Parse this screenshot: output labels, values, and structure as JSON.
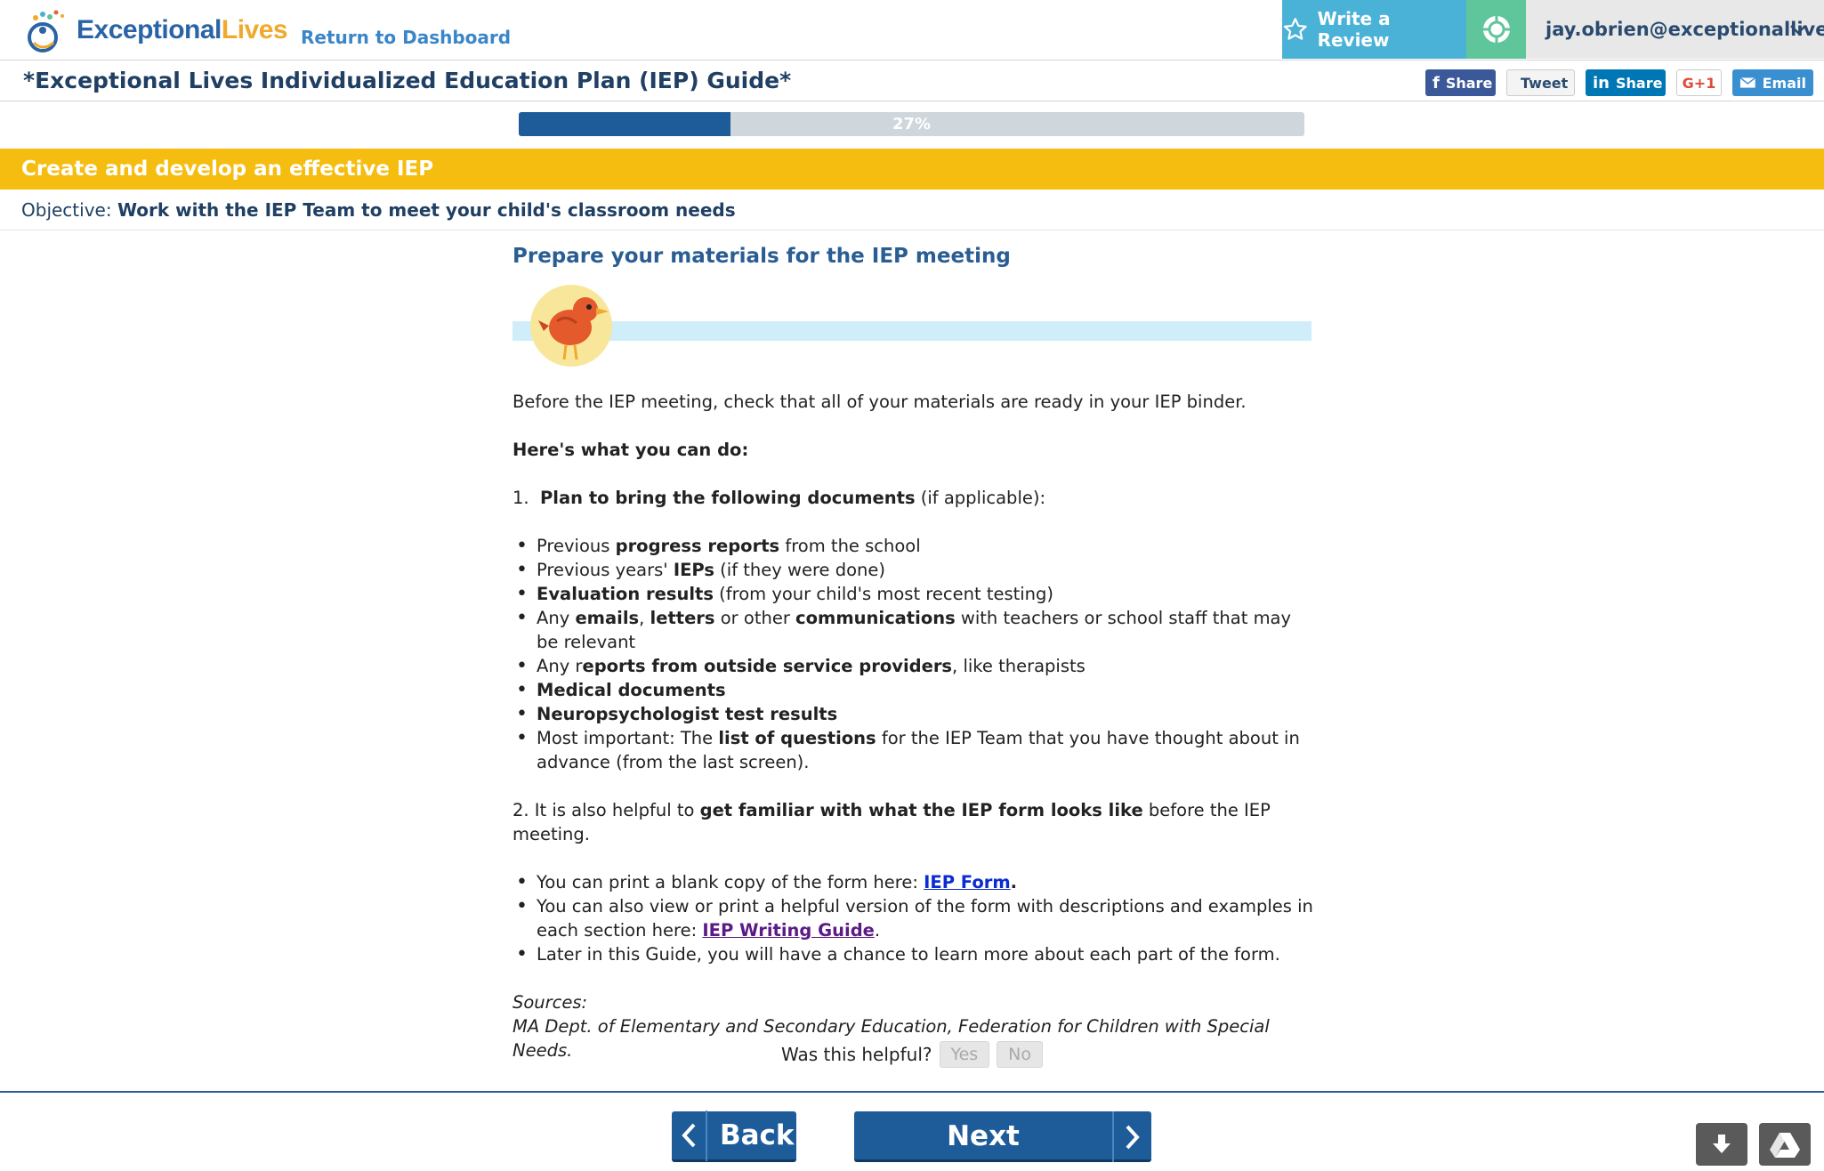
{
  "header": {
    "logo": {
      "part1": "Exceptional",
      "part2": "Lives"
    },
    "return_link": "Return to Dashboard",
    "write_review": "Write a Review",
    "user_email": "jay.obrien@exceptionallive"
  },
  "titlebar": {
    "title": "*Exceptional Lives Individualized Education Plan (IEP) Guide*",
    "share": {
      "facebook": "Share",
      "twitter": "Tweet",
      "linkedin": "Share",
      "google": "G+1",
      "email": "Email"
    }
  },
  "progress": {
    "label": "27%",
    "value": 0.27
  },
  "section": {
    "banner": "Create and develop an effective IEP",
    "objective_label": "Objective:",
    "objective_text": "Work with the IEP Team to meet your child's classroom needs"
  },
  "content": {
    "heading": "Prepare your materials for the IEP meeting",
    "intro": "Before the IEP meeting, check that all of your materials are ready in your IEP binder.",
    "what_you_can_do": "Here's what you can do:",
    "step1": {
      "num": "1.",
      "bold": "Plan to bring the following documents",
      "rest": " (if applicable):"
    },
    "docs": [
      {
        "a": "Previous ",
        "b": "progress reports",
        "c": " from the school"
      },
      {
        "a": "Previous years' ",
        "b": "IEPs",
        "c": " (if they were done)"
      },
      {
        "a": "",
        "b": "Evaluation results",
        "c": " (from your child's most recent testing)"
      },
      {
        "a": "Any ",
        "b": "emails",
        "c": ", ",
        "d": "letters",
        "e": " or other ",
        "f": "communications",
        "g": " with teachers or school staff that may be relevant"
      },
      {
        "a": "Any r",
        "b": "eports from outside service providers",
        "c": ", like therapists"
      },
      {
        "a": "",
        "b": "Medical documents",
        "c": ""
      },
      {
        "a": "",
        "b": "Neuropsychologist test results",
        "c": ""
      },
      {
        "a": "Most important: The ",
        "b": "list of questions",
        "c": " for the IEP Team that you have thought about in advance (from the last screen)."
      }
    ],
    "step2": {
      "a": "2. It is also helpful to ",
      "b": "get familiar with what the IEP form looks like",
      "c": " before the IEP meeting."
    },
    "form_items": {
      "print_text": "You can print a blank copy of the form here: ",
      "print_link": "IEP Form",
      "print_end": ".",
      "guide_text": "You can also view or print a helpful version of the form with descriptions and examples in each section here: ",
      "guide_link": "IEP Writing Guide",
      "guide_end": ".",
      "later": "Later in this Guide, you will have a chance to learn more about each part of the form."
    },
    "sources_label": "Sources:",
    "sources": "MA Dept. of Elementary and Secondary Education, Federation for Children with Special Needs."
  },
  "feedback": {
    "question": "Was this helpful?",
    "yes": "Yes",
    "no": "No"
  },
  "nav": {
    "back": "Back",
    "next": "Next"
  },
  "icons": {
    "star": "star-icon",
    "target": "target-icon",
    "chevron": "chevron-down-icon",
    "download": "download-icon",
    "drive": "google-drive-icon"
  },
  "colors": {
    "brand_blue": "#1e5c99",
    "banner_yellow": "#f5bd0f",
    "review_teal": "#4ab2d6",
    "target_green": "#5fc59b"
  }
}
